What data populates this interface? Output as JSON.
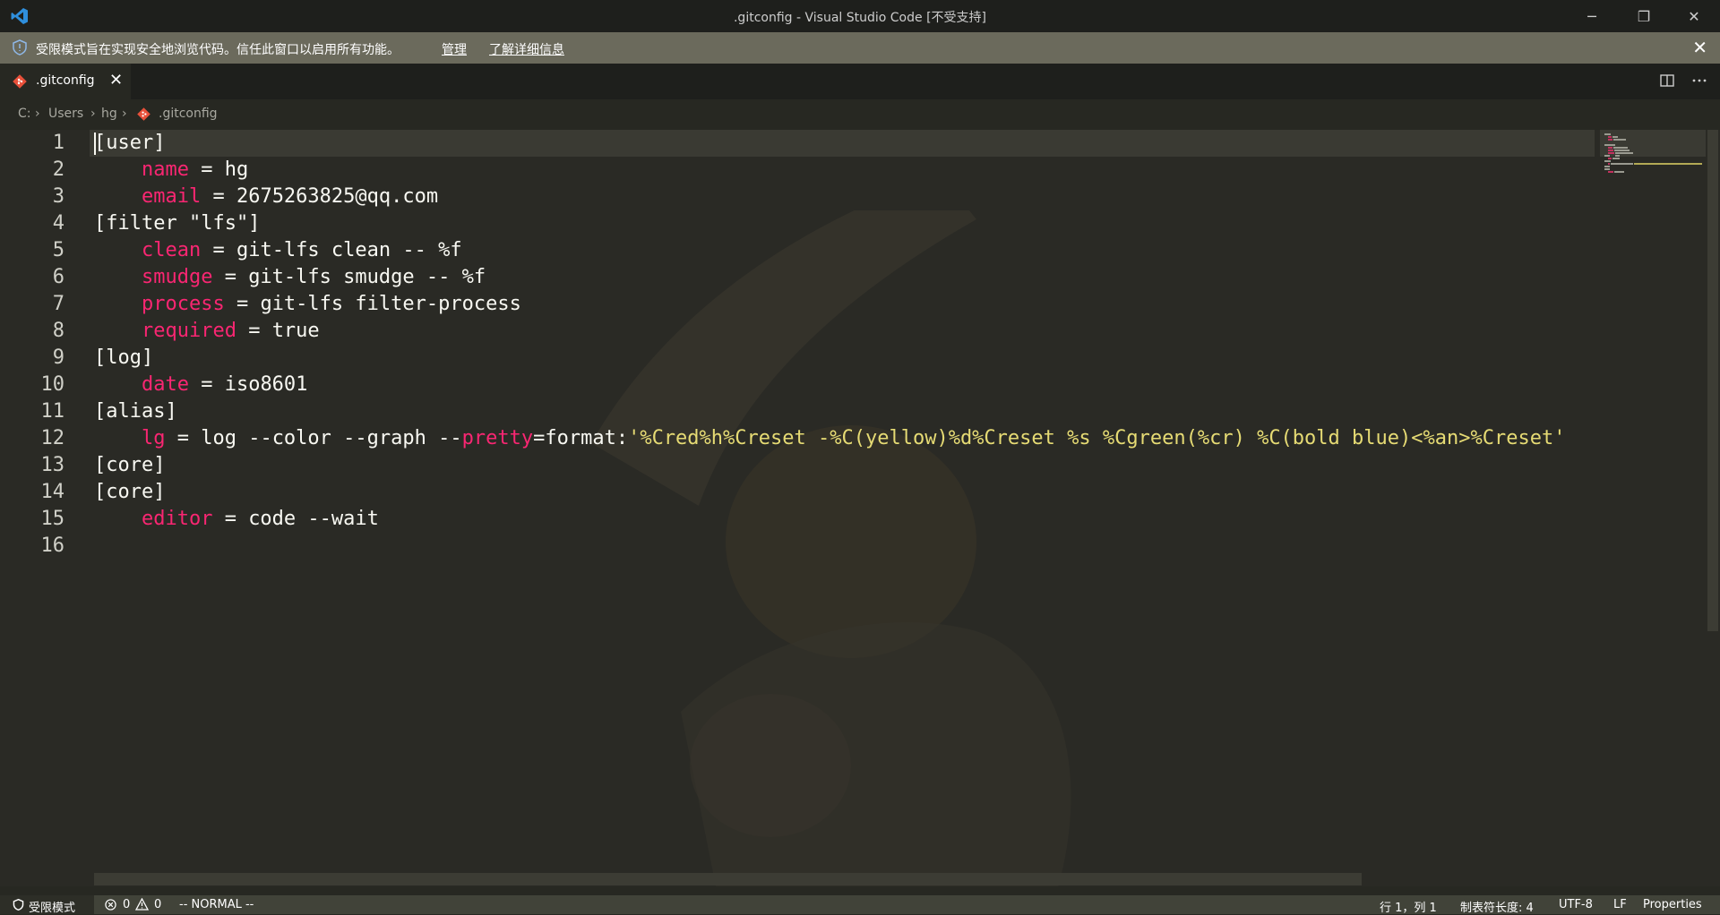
{
  "window": {
    "title": ".gitconfig - Visual Studio Code [不受支持]",
    "minimize": "─",
    "restore": "❐",
    "close": "✕"
  },
  "banner": {
    "message": "受限模式旨在实现安全地浏览代码。信任此窗口以启用所有功能。",
    "manage": "管理",
    "learn_more": "了解详细信息",
    "close": "✕"
  },
  "tab": {
    "label": ".gitconfig",
    "close": "✕"
  },
  "breadcrumb": {
    "drive": "C:",
    "sep1": "›",
    "users": "Users",
    "sep2": "›",
    "user": "hg",
    "sep3": "›",
    "file": ".gitconfig"
  },
  "editor": {
    "line_numbers": [
      "1",
      "2",
      "3",
      "4",
      "5",
      "6",
      "7",
      "8",
      "9",
      "10",
      "11",
      "12",
      "13",
      "14",
      "15",
      "16"
    ],
    "lines": [
      {
        "key": "",
        "text": "[user]"
      },
      {
        "key": "    name",
        "text": " = hg"
      },
      {
        "key": "    email",
        "text": " = 2675263825@qq.com"
      },
      {
        "key": "",
        "text": "[filter \"lfs\"]"
      },
      {
        "key": "    clean",
        "text": " = git-lfs clean -- %f"
      },
      {
        "key": "    smudge",
        "text": " = git-lfs smudge -- %f"
      },
      {
        "key": "    process",
        "text": " = git-lfs filter-process"
      },
      {
        "key": "    required",
        "text": " = true"
      },
      {
        "key": "",
        "text": "[log]"
      },
      {
        "key": "    date",
        "text": " = iso8601"
      },
      {
        "key": "",
        "text": "[alias]"
      },
      {
        "key": "    lg",
        "text": " = log --color --graph --"
      },
      {
        "key": "",
        "text": "[core]"
      },
      {
        "key": "",
        "text": "[core]"
      },
      {
        "key": "    editor",
        "text": " = code --wait"
      },
      {
        "key": "",
        "text": ""
      }
    ],
    "line12_pretty": "pretty",
    "line12_format": "=format:",
    "line12_string": "'%Cred%h%Creset -%C(yellow)%d%Creset %s %Cgreen(%cr) %C(bold blue)<%an>%Creset'"
  },
  "status": {
    "restricted": "受限模式",
    "errors": "0",
    "warnings": "0",
    "vim_mode": "-- NORMAL --",
    "position": "行 1，列 1",
    "tab_size": "制表符长度: 4",
    "encoding": "UTF-8",
    "eol": "LF",
    "language": "Properties"
  },
  "colors": {
    "keyword": "#f92672",
    "string": "#e6db74",
    "background": "#272822"
  }
}
